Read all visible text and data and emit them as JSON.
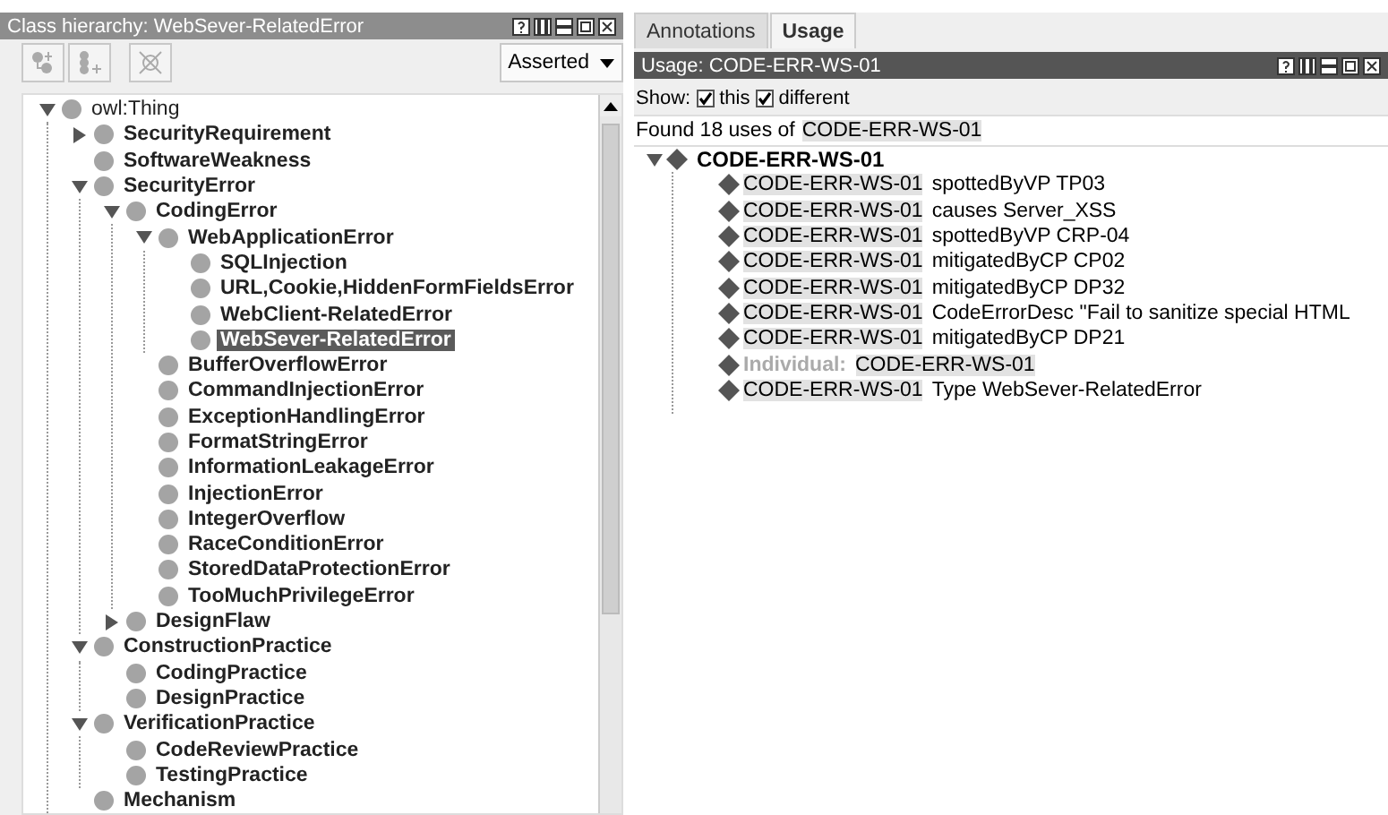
{
  "class_hierarchy": {
    "title": "Class hierarchy: WebSever-RelatedError",
    "mode": "Asserted",
    "tree": [
      {
        "label": "owl:Thing",
        "expanded": true,
        "selected": false,
        "children": [
          {
            "label": "SecurityRequirement",
            "expanded": false,
            "selected": false
          },
          {
            "label": "SoftwareWeakness",
            "selected": false
          },
          {
            "label": "SecurityError",
            "expanded": true,
            "selected": false,
            "children": [
              {
                "label": "CodingError",
                "expanded": true,
                "selected": false,
                "children": [
                  {
                    "label": "WebApplicationError",
                    "expanded": true,
                    "selected": false,
                    "children": [
                      {
                        "label": "SQLInjection",
                        "selected": false
                      },
                      {
                        "label": "URL,Cookie,HiddenFormFieldsError",
                        "selected": false
                      },
                      {
                        "label": "WebClient-RelatedError",
                        "selected": false
                      },
                      {
                        "label": "WebSever-RelatedError",
                        "selected": true
                      }
                    ]
                  },
                  {
                    "label": "BufferOverflowError",
                    "selected": false
                  },
                  {
                    "label": "CommandInjectionError",
                    "selected": false
                  },
                  {
                    "label": "ExceptionHandlingError",
                    "selected": false
                  },
                  {
                    "label": "FormatStringError",
                    "selected": false
                  },
                  {
                    "label": "InformationLeakageError",
                    "selected": false
                  },
                  {
                    "label": "InjectionError",
                    "selected": false
                  },
                  {
                    "label": "IntegerOverflow",
                    "selected": false
                  },
                  {
                    "label": "RaceConditionError",
                    "selected": false
                  },
                  {
                    "label": "StoredDataProtectionError",
                    "selected": false
                  },
                  {
                    "label": "TooMuchPrivilegeError",
                    "selected": false
                  }
                ]
              },
              {
                "label": "DesignFlaw",
                "expanded": false,
                "selected": false
              }
            ]
          },
          {
            "label": "ConstructionPractice",
            "expanded": true,
            "selected": false,
            "children": [
              {
                "label": "CodingPractice",
                "selected": false
              },
              {
                "label": "DesignPractice",
                "selected": false
              }
            ]
          },
          {
            "label": "VerificationPractice",
            "expanded": true,
            "selected": false,
            "children": [
              {
                "label": "CodeReviewPractice",
                "selected": false
              },
              {
                "label": "TestingPractice",
                "selected": false
              }
            ]
          },
          {
            "label": "Mechanism",
            "selected": false
          }
        ]
      }
    ]
  },
  "tabs": [
    {
      "label": "Annotations",
      "selected": false
    },
    {
      "label": "Usage",
      "selected": true
    }
  ],
  "usage": {
    "title": "Usage: CODE-ERR-WS-01",
    "show_label": "Show:",
    "options": [
      {
        "label": "this",
        "checked": true
      },
      {
        "label": "different",
        "checked": true
      }
    ],
    "found_text": "Found 18 uses of",
    "found_entity": "CODE-ERR-WS-01",
    "root": {
      "label": "CODE-ERR-WS-01",
      "expanded": true,
      "uses": [
        {
          "kind": "axiom",
          "subject": "CODE-ERR-WS-01",
          "text": "spottedByVP TP03"
        },
        {
          "kind": "axiom",
          "subject": "CODE-ERR-WS-01",
          "text": "causes Server_XSS"
        },
        {
          "kind": "axiom",
          "subject": "CODE-ERR-WS-01",
          "text": "spottedByVP CRP-04"
        },
        {
          "kind": "axiom",
          "subject": "CODE-ERR-WS-01",
          "text": "mitigatedByCP CP02"
        },
        {
          "kind": "axiom",
          "subject": "CODE-ERR-WS-01",
          "text": "mitigatedByCP DP32"
        },
        {
          "kind": "axiom",
          "subject": "CODE-ERR-WS-01",
          "text": "CodeErrorDesc \"Fail to sanitize special HTML"
        },
        {
          "kind": "axiom",
          "subject": "CODE-ERR-WS-01",
          "text": "mitigatedByCP DP21"
        },
        {
          "kind": "declaration",
          "label": "Individual:",
          "subject": "CODE-ERR-WS-01"
        },
        {
          "kind": "axiom",
          "subject": "CODE-ERR-WS-01",
          "text": "Type WebSever-RelatedError"
        }
      ]
    }
  }
}
